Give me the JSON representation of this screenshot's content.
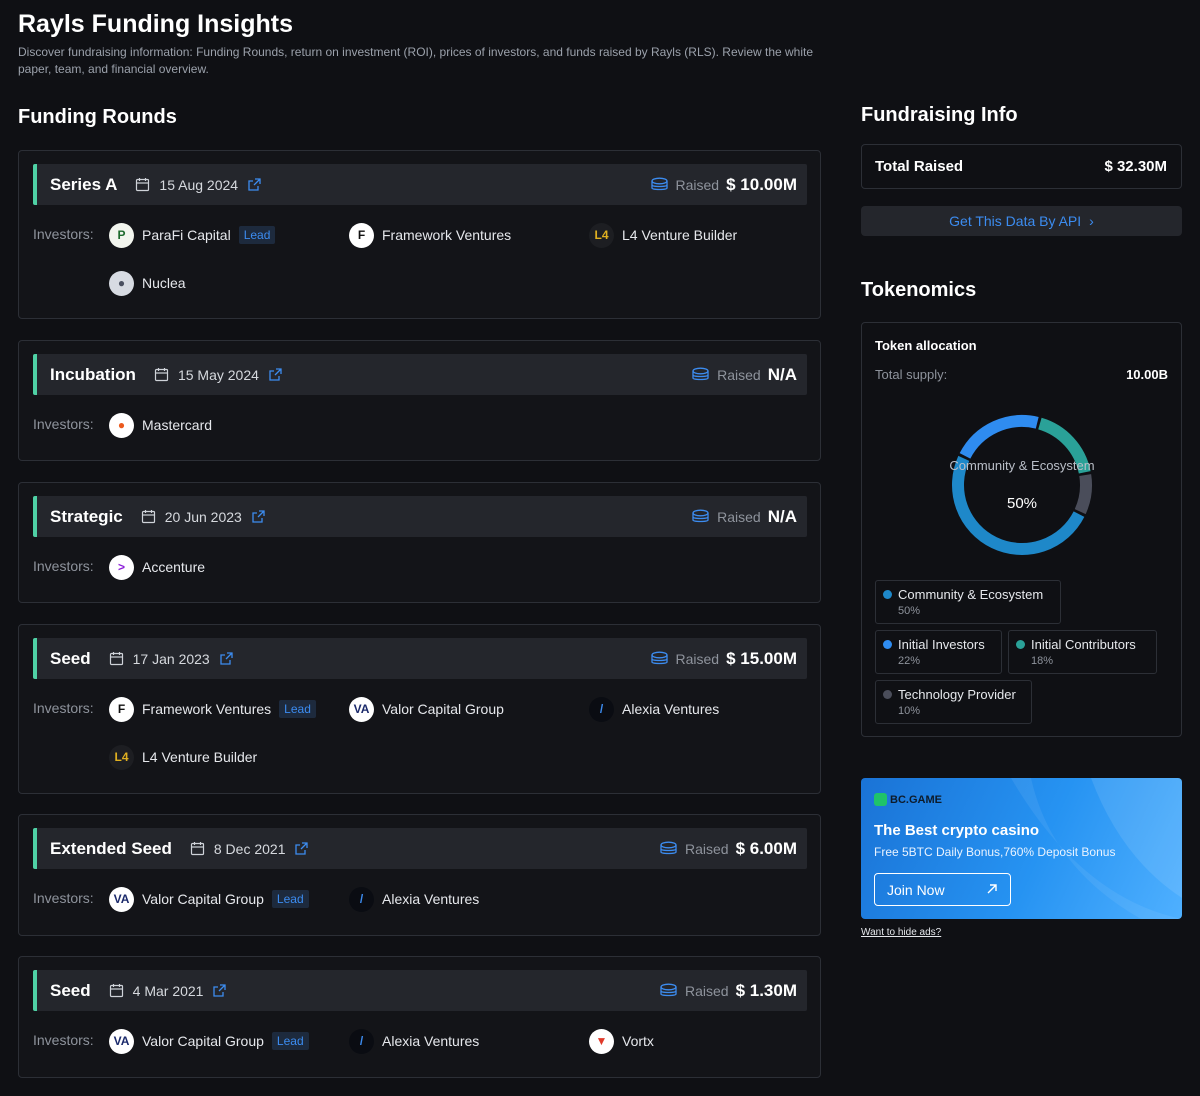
{
  "header": {
    "title": "Rayls Funding Insights",
    "description": "Discover fundraising information: Funding Rounds, return on investment (ROI), prices of investors, and funds raised by Rayls (RLS). Review the white paper, team, and financial overview."
  },
  "funding": {
    "title": "Funding Rounds",
    "investors_label": "Investors:",
    "raised_label": "Raised",
    "lead_label": "Lead",
    "rounds": [
      {
        "name": "Series A",
        "date": "15 Aug 2024",
        "raised": "$ 10.00M",
        "investors": [
          {
            "name": "ParaFi Capital",
            "logo": "parafi-logo"
          },
          {
            "name": "Framework Ventures",
            "logo": "framework-logo"
          },
          {
            "name": "L4 Venture Builder",
            "logo": "l4-logo"
          },
          {
            "name": "Nuclea",
            "logo": "person-icon"
          }
        ]
      },
      {
        "name": "Incubation",
        "date": "15 May 2024",
        "raised": "N/A",
        "investors": [
          {
            "name": "Mastercard",
            "logo": "mastercard-logo"
          }
        ]
      },
      {
        "name": "Strategic",
        "date": "20 Jun 2023",
        "raised": "N/A",
        "investors": [
          {
            "name": "Accenture",
            "logo": "accenture-logo"
          }
        ]
      },
      {
        "name": "Seed",
        "date": "17 Jan 2023",
        "raised": "$ 15.00M",
        "investors": [
          {
            "name": "Framework Ventures",
            "logo": "framework-logo"
          },
          {
            "name": "Valor Capital Group",
            "logo": "valor-logo"
          },
          {
            "name": "Alexia Ventures",
            "logo": "alexia-logo"
          },
          {
            "name": "L4 Venture Builder",
            "logo": "l4-logo"
          }
        ]
      },
      {
        "name": "Extended Seed",
        "date": "8 Dec 2021",
        "raised": "$ 6.00M",
        "investors": [
          {
            "name": "Valor Capital Group",
            "logo": "valor-logo"
          },
          {
            "name": "Alexia Ventures",
            "logo": "alexia-logo"
          }
        ]
      },
      {
        "name": "Seed",
        "date": "4 Mar 2021",
        "raised": "$ 1.30M",
        "investors": [
          {
            "name": "Valor Capital Group",
            "logo": "valor-logo"
          },
          {
            "name": "Alexia Ventures",
            "logo": "alexia-logo"
          },
          {
            "name": "Vortx",
            "logo": "vortx-logo"
          }
        ]
      }
    ]
  },
  "fundraising": {
    "title": "Fundraising Info",
    "total_label": "Total Raised",
    "total_value": "$ 32.30M",
    "api_button": "Get This Data By API"
  },
  "tokenomics": {
    "title": "Tokenomics",
    "allocation_title": "Token allocation",
    "supply_label": "Total supply:",
    "supply_value": "10.00B",
    "center_label": "Community & Ecosystem",
    "center_pct": "50%",
    "segments": [
      {
        "name": "Community & Ecosystem",
        "pct": "50%",
        "value": 50,
        "color": "#1e88c9"
      },
      {
        "name": "Initial Investors",
        "pct": "22%",
        "value": 22,
        "color": "#2f8cf0"
      },
      {
        "name": "Initial Contributors",
        "pct": "18%",
        "value": 18,
        "color": "#2aa198"
      },
      {
        "name": "Technology Provider",
        "pct": "10%",
        "value": 10,
        "color": "#4a4d5a"
      }
    ]
  },
  "ad": {
    "brand": "BC.GAME",
    "title": "The Best crypto casino",
    "subtitle": "Free 5BTC Daily Bonus,760% Deposit Bonus",
    "button": "Join Now",
    "hide_link": "Want to hide ads?"
  },
  "colors": {
    "accent": "#3c8cf0",
    "round_marker": "#4fd1a5",
    "background": "#0f1014"
  }
}
